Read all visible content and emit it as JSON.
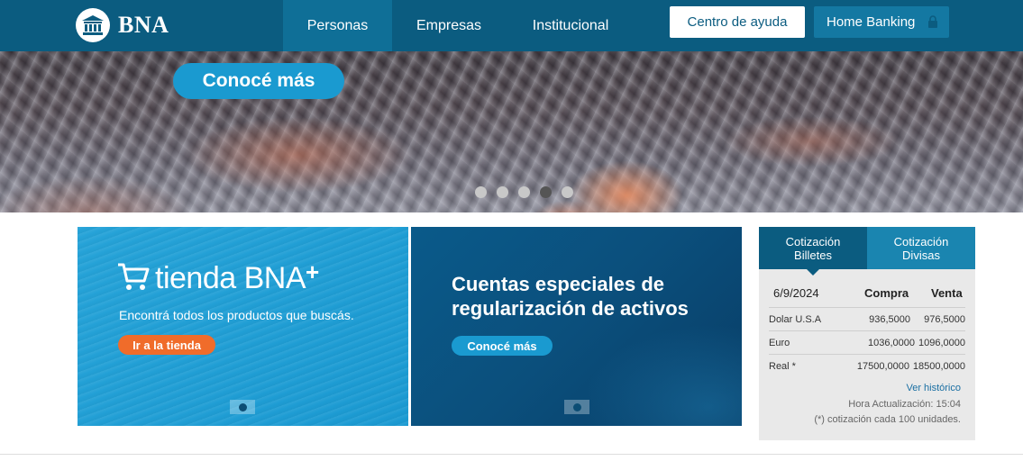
{
  "header": {
    "logo_text": "BNA",
    "nav": [
      "Personas",
      "Empresas",
      "Institucional"
    ],
    "help_label": "Centro de ayuda",
    "home_banking_label": "Home Banking"
  },
  "hero": {
    "button_label": "Conocé más",
    "slides_total": 5,
    "active_slide": 4
  },
  "banners": {
    "tienda": {
      "title": "tienda BNA",
      "plus": "+",
      "subtitle": "Encontrá todos los productos que buscás.",
      "button": "Ir a la tienda"
    },
    "cuentas": {
      "title": "Cuentas especiales de regularización de activos",
      "button": "Conocé más"
    }
  },
  "cotizacion": {
    "tab_billetes": [
      "Cotización",
      "Billetes"
    ],
    "tab_divisas": [
      "Cotización",
      "Divisas"
    ],
    "date": "6/9/2024",
    "col_compra": "Compra",
    "col_venta": "Venta",
    "rows": [
      {
        "name": "Dolar U.S.A",
        "compra": "936,5000",
        "venta": "976,5000"
      },
      {
        "name": "Euro",
        "compra": "1036,0000",
        "venta": "1096,0000"
      },
      {
        "name": "Real *",
        "compra": "17500,0000",
        "venta": "18500,0000"
      }
    ],
    "historico": "Ver histórico",
    "hora": "Hora Actualización: 15:04",
    "nota": "(*) cotización cada 100 unidades."
  },
  "colors": {
    "brand": "#0b5c80",
    "accent": "#1a9ad0",
    "orange": "#f06c2a"
  }
}
